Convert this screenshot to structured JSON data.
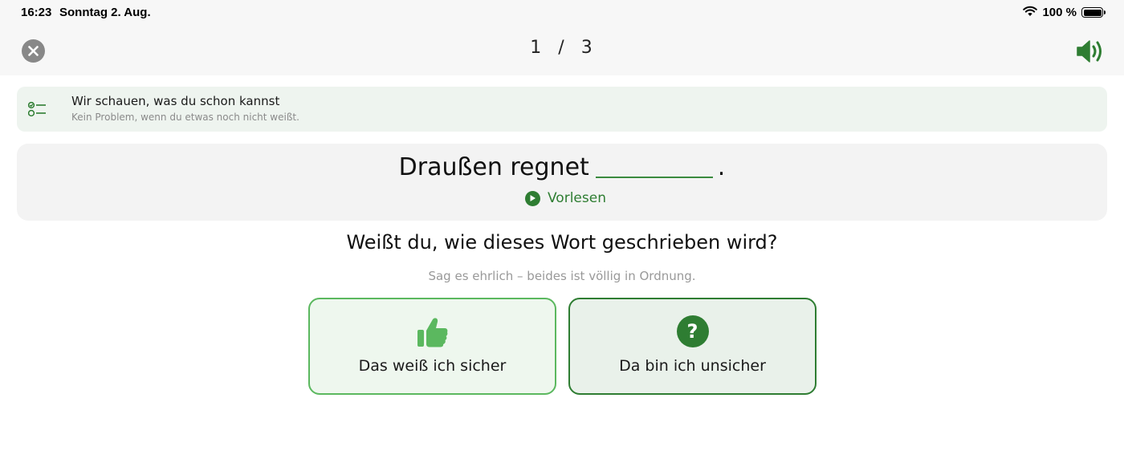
{
  "status_bar": {
    "time": "16:23",
    "date": "Sonntag 2. Aug.",
    "battery_text": "100 %",
    "battery_level": 1.0,
    "icons": [
      "wifi-icon",
      "battery-icon"
    ]
  },
  "header": {
    "progress_current": "1",
    "progress_separator": "/",
    "progress_total": "3",
    "icons": [
      "close-icon",
      "speaker-icon"
    ]
  },
  "info_banner": {
    "title": "Wir schauen, was du schon kannst",
    "subtitle": "Kein Problem, wenn du etwas noch nicht weißt.",
    "icon": "checklist-icon"
  },
  "exercise": {
    "sentence_start": "Draußen regnet",
    "sentence_end": ".",
    "read_aloud_label": "Vorlesen"
  },
  "prompt": {
    "question": "Weißt du, wie dieses Wort geschrieben wird?",
    "hint": "Sag es ehrlich – beides ist völlig in Ordnung."
  },
  "choices": [
    {
      "label": "Das weiß ich sicher",
      "icon": "thumbs-up-icon"
    },
    {
      "label": "Da bin ich unsicher",
      "icon": "question-icon",
      "icon_glyph": "?"
    }
  ],
  "colors": {
    "accent_dark": "#2e7d32",
    "accent_light": "#5bb85f",
    "banner_bg": "#eef4ef",
    "card_bg": "#f3f3f3"
  }
}
